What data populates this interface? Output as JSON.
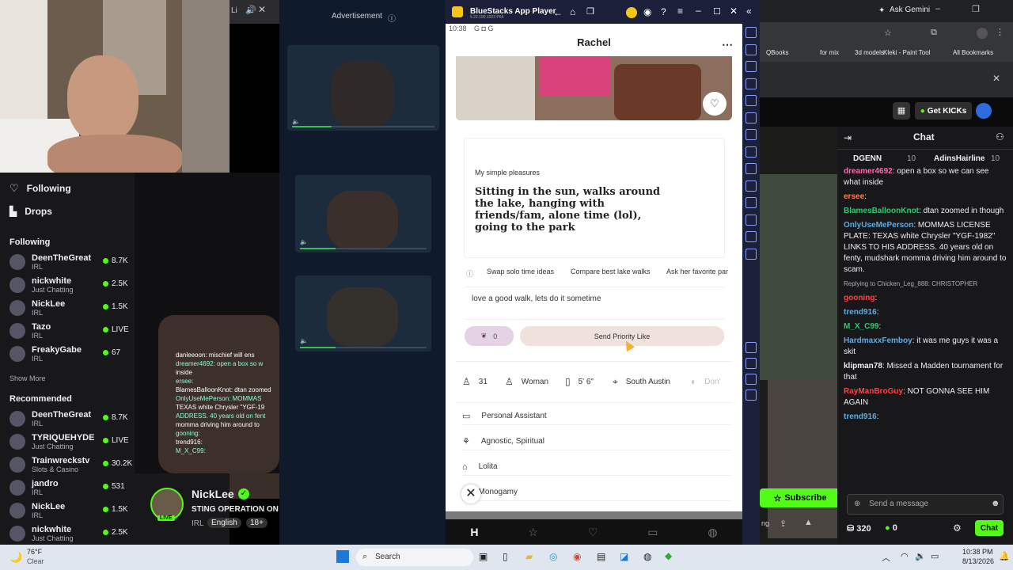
{
  "taskbar": {
    "weather_temp": "76°F",
    "weather_desc": "Clear",
    "search": "Search",
    "time": "10:38 PM",
    "date": "8/13/2026"
  },
  "twitch": {
    "nav": {
      "following": "Following",
      "drops": "Drops"
    },
    "following_header": "Following",
    "following": [
      {
        "name": "DeenTheGreat",
        "sub": "IRL",
        "count": "8.7K"
      },
      {
        "name": "nickwhite",
        "sub": "Just Chatting",
        "count": "2.5K"
      },
      {
        "name": "NickLee",
        "sub": "IRL",
        "count": "1.5K"
      },
      {
        "name": "Tazo",
        "sub": "IRL",
        "count": "LIVE"
      },
      {
        "name": "FreakyGabe",
        "sub": "IRL",
        "count": "67"
      }
    ],
    "show_more": "Show More",
    "recommended_header": "Recommended",
    "recommended": [
      {
        "name": "DeenTheGreat",
        "sub": "IRL",
        "count": "8.7K"
      },
      {
        "name": "TYRIQUEHYDE",
        "sub": "Just Chatting",
        "count": "LIVE"
      },
      {
        "name": "Trainwreckstv",
        "sub": "Slots & Casino",
        "count": "30.2K"
      },
      {
        "name": "jandro",
        "sub": "IRL",
        "count": "531"
      },
      {
        "name": "NickLee",
        "sub": "IRL",
        "count": "1.5K"
      },
      {
        "name": "nickwhite",
        "sub": "Just Chatting",
        "count": "2.5K"
      }
    ],
    "overlay_chat": [
      "danleeoon: mischief will ens",
      "dreamer4692: open a box so w",
      "inside",
      "ersee:",
      "BlamesBalloonKnot: dtan zoomed",
      "OnlyUseMePerson: MOMMAS",
      "TEXAS white Chrysler \"YGF-19",
      "ADDRESS. 40 years old on fent",
      "momma driving him around to",
      "gooning:",
      "trend916:",
      "M_X_C99:"
    ],
    "streamer": {
      "name": "NickLee",
      "title": "STING OPERATION ON T",
      "cat": "IRL",
      "lang": "English",
      "age": "18+",
      "live": "LIVE"
    },
    "tab_title": "Li"
  },
  "ad": {
    "label": "Advertisement"
  },
  "bluestacks": {
    "title": "BlueStacks App Player",
    "subtitle": "5.22.100.1023 P64",
    "status_time": "10:38",
    "profile_name": "Rachel",
    "prompt_label": "My simple pleasures",
    "prompt_answer": "Sitting in the sun, walks around the lake, hanging with friends/fam, alone time (lol), going to the park",
    "chips": [
      "Swap solo time ideas",
      "Compare best lake walks",
      "Ask her favorite par"
    ],
    "comment": "love a good walk, lets do it sometime",
    "rose_count": "0",
    "priority_like": "Send Priority Like",
    "stats": [
      "31",
      "Woman",
      "5' 6\"",
      "South Austin",
      "Don'"
    ],
    "details": [
      "Personal Assistant",
      "Agnostic, Spiritual",
      "Lolita",
      "Monogamy"
    ],
    "colors": {
      "accent": "#6b3a6b",
      "priority_bg": "#efe1dc"
    }
  },
  "browser": {
    "ask_gemini": "Ask Gemini",
    "bookmarks": [
      "QBooks",
      "for mix",
      "3d models",
      "Kleki - Paint Tool",
      "All Bookmarks"
    ],
    "get_kicks": "Get KICKs"
  },
  "chat": {
    "title": "Chat",
    "top": [
      {
        "name": "DGENN",
        "n": "10"
      },
      {
        "name": "AdinsHairline",
        "n": "10"
      }
    ],
    "lines": [
      {
        "u": "dreamer4692",
        "c": "#ff69b4",
        "t": ": open a box so we can see what inside"
      },
      {
        "u": "ersee",
        "c": "#ff7f50",
        "t": ":"
      },
      {
        "u": "BlamesBalloonKnot",
        "c": "#2ecc71",
        "t": ": dtan zoomed in though"
      },
      {
        "u": "OnlyUseMePerson",
        "c": "#5dade2",
        "t": ": MOMMAS LICENSE PLATE: TEXAS white Chrysler \"YGF-1982\" LINKS TO HIS ADDRESS. 40 years old on fenty, mudshark momma driving him around to scam."
      },
      {
        "u": "",
        "c": "#adadb8",
        "t": "Replying to Chicken_Leg_888: CHRISTOPHER"
      },
      {
        "u": "gooning",
        "c": "#ff4444",
        "t": ":"
      },
      {
        "u": "trend916",
        "c": "#5dade2",
        "t": ":"
      },
      {
        "u": "M_X_C99",
        "c": "#2ecc71",
        "t": ":"
      },
      {
        "u": "HardmaxxFemboy",
        "c": "#5dade2",
        "t": ": it was me guys it was a skit"
      },
      {
        "u": "klipman78",
        "c": "#efeff1",
        "t": ": Missed a Madden tournament for that"
      },
      {
        "u": "RayManBroGuy",
        "c": "#ff4444",
        "t": ": NOT GONNA SEE HIM AGAIN"
      },
      {
        "u": "trend916",
        "c": "#5dade2",
        "t": ":"
      }
    ],
    "subscribe": "Subscribe",
    "placeholder": "Send a message",
    "points": "320",
    "kicks": "0",
    "chat_btn": "Chat"
  }
}
